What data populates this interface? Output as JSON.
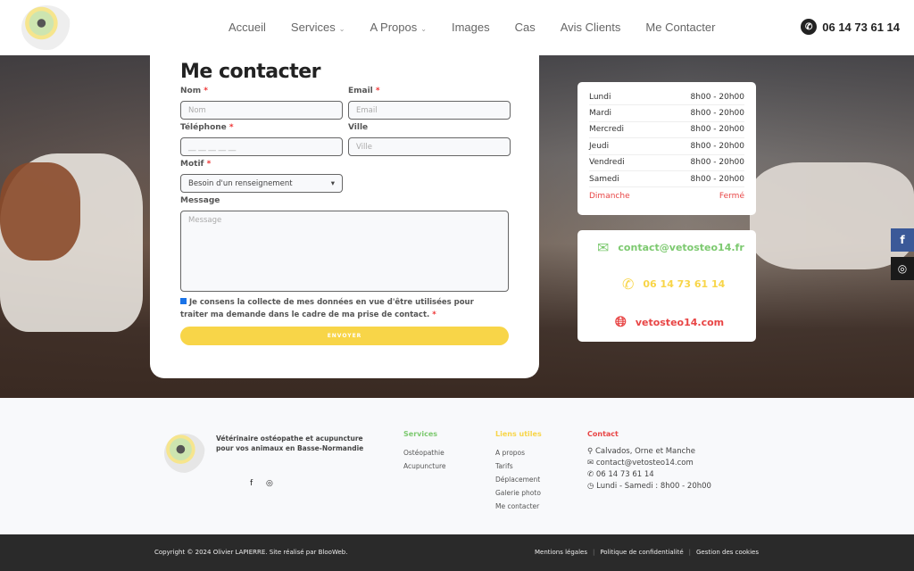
{
  "header": {
    "nav": [
      "Accueil",
      "Services",
      "A Propos",
      "Images",
      "Cas",
      "Avis Clients",
      "Me Contacter"
    ],
    "phone": "06 14 73 61 14"
  },
  "form": {
    "title": "Me contacter",
    "nom_label": "Nom",
    "nom_placeholder": "Nom",
    "email_label": "Email",
    "email_placeholder": "Email",
    "tel_label": "Téléphone",
    "tel_placeholder": "__ __ __ __ __",
    "ville_label": "Ville",
    "ville_placeholder": "Ville",
    "motif_label": "Motif",
    "motif_value": "Besoin d'un renseignement",
    "message_label": "Message",
    "message_placeholder": "Message",
    "consent": "Je consens la collecte de mes données en vue d'être utilisées pour traiter ma demande dans le cadre de ma prise de contact.",
    "required_mark": "*",
    "submit": "ENVOYER"
  },
  "hours": [
    {
      "day": "Lundi",
      "time": "8h00 - 20h00"
    },
    {
      "day": "Mardi",
      "time": "8h00 - 20h00"
    },
    {
      "day": "Mercredi",
      "time": "8h00 - 20h00"
    },
    {
      "day": "Jeudi",
      "time": "8h00 - 20h00"
    },
    {
      "day": "Vendredi",
      "time": "8h00 - 20h00"
    },
    {
      "day": "Samedi",
      "time": "8h00 - 20h00"
    },
    {
      "day": "Dimanche",
      "time": "Fermé"
    }
  ],
  "contact": {
    "email": "contact@vetosteo14.fr",
    "phone": "06 14 73 61 14",
    "website": "vetosteo14.com"
  },
  "colors": {
    "green": "#7cc96f",
    "yellow": "#f8d548",
    "red": "#e84545",
    "facebook": "#3b5998"
  },
  "footer": {
    "tagline": "Vétérinaire ostéopathe et acupuncture pour vos animaux en Basse-Normandie",
    "services": {
      "title": "Services",
      "items": [
        "Ostéopathie",
        "Acupuncture"
      ]
    },
    "links": {
      "title": "Liens utiles",
      "items": [
        "A propos",
        "Tarifs",
        "Déplacement",
        "Galerie photo",
        "Me contacter"
      ]
    },
    "contact": {
      "title": "Contact",
      "items": [
        "Calvados, Orne et Manche",
        "contact@vetosteo14.com",
        "06 14 73 61 14",
        "Lundi - Samedi : 8h00 - 20h00"
      ]
    },
    "copyright": "Copyright © 2024 Olivier LAPIERRE. Site réalisé par BlooWeb.",
    "legal": [
      "Mentions légales",
      "Politique de confidentialité",
      "Gestion des cookies"
    ]
  }
}
